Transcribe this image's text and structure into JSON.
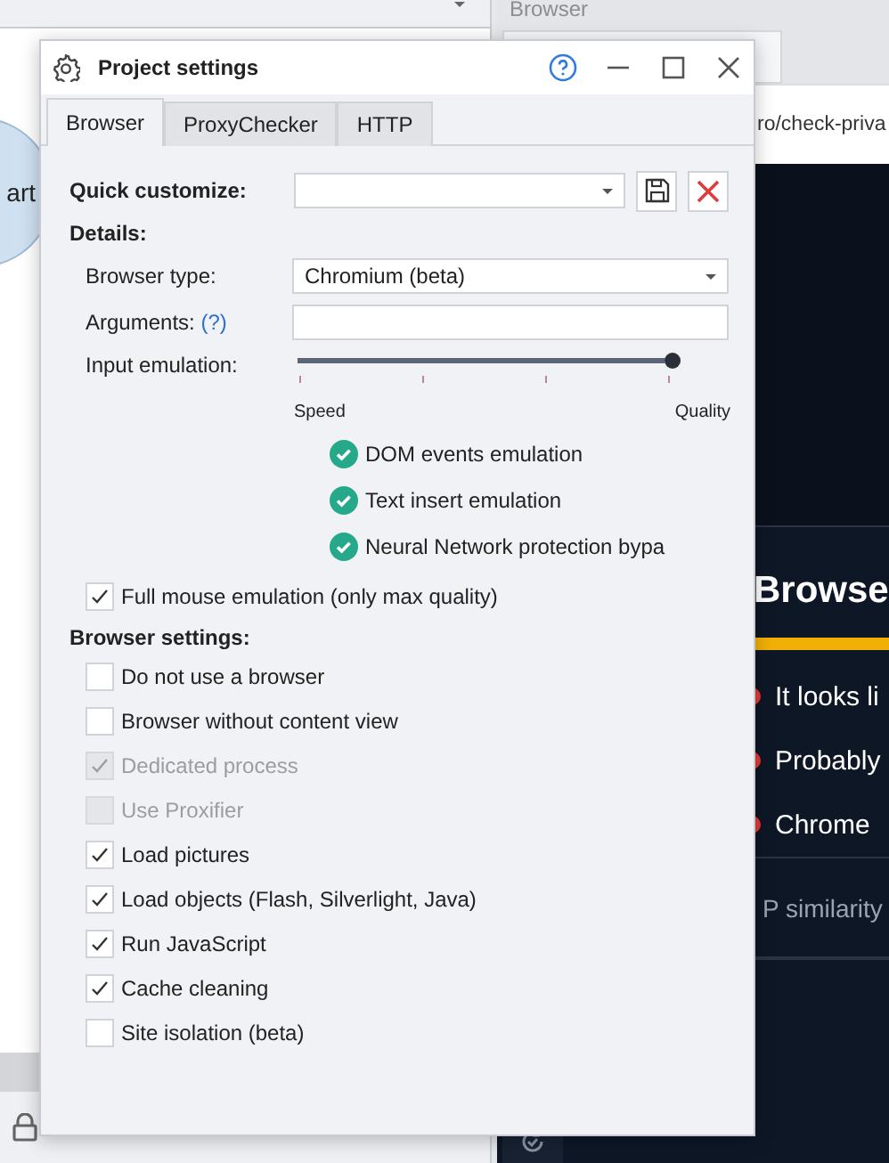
{
  "background": {
    "left_panel": {
      "label": "art"
    },
    "browser": {
      "title": "Browser",
      "url": "ro/check-priva",
      "heading": "Browse",
      "bullets": [
        "It looks li",
        "Probably",
        "Chrome"
      ],
      "footer": "P similarity"
    }
  },
  "dialog": {
    "title": "Project settings",
    "tabs": [
      {
        "label": "Browser",
        "selected": true
      },
      {
        "label": "ProxyChecker",
        "selected": false
      },
      {
        "label": "HTTP",
        "selected": false
      }
    ],
    "quick_customize": {
      "label": "Quick customize:"
    },
    "details": {
      "heading": "Details:",
      "browser_type": {
        "label": "Browser type:",
        "value": "Chromium (beta)"
      },
      "arguments": {
        "label": "Arguments:",
        "help": "(?)"
      },
      "input_emulation": {
        "label": "Input emulation:",
        "level": 1,
        "min_label": "Speed",
        "max_label": "Quality"
      },
      "features": [
        {
          "label": "DOM events emulation",
          "checked": true
        },
        {
          "label": "Text insert emulation",
          "checked": true
        },
        {
          "label": "Neural Network protection bypa",
          "checked": true
        }
      ],
      "full_mouse": {
        "label": "Full mouse emulation (only max quality)",
        "checked": true
      }
    },
    "browser_settings": {
      "heading": "Browser settings:",
      "options": [
        {
          "label": "Do not use a browser",
          "checked": false,
          "disabled": false
        },
        {
          "label": "Browser without content view",
          "checked": false,
          "disabled": false
        },
        {
          "label": "Dedicated process",
          "checked": true,
          "disabled": true
        },
        {
          "label": "Use Proxifier",
          "checked": false,
          "disabled": true
        },
        {
          "label": "Load pictures",
          "checked": true,
          "disabled": false
        },
        {
          "label": "Load objects (Flash, Silverlight, Java)",
          "checked": true,
          "disabled": false
        },
        {
          "label": "Run JavaScript",
          "checked": true,
          "disabled": false
        },
        {
          "label": "Cache cleaning",
          "checked": true,
          "disabled": false
        },
        {
          "label": "Site isolation (beta)",
          "checked": false,
          "disabled": false
        }
      ]
    }
  }
}
